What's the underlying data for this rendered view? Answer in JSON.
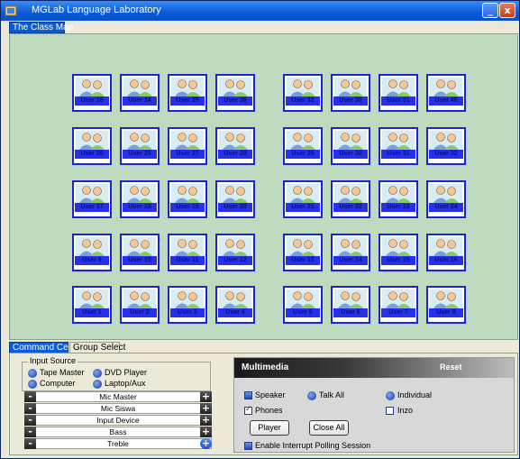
{
  "window": {
    "title": "MGLab Language Laboratory",
    "minimize_label": "_",
    "close_label": "x"
  },
  "top_tabs": [
    {
      "label": "The Class Map"
    }
  ],
  "seats": [
    "User 16",
    "User 14",
    "User 25",
    "User 36",
    "User 32",
    "User 30",
    "User 31",
    "User 40",
    "User 26",
    "User 25",
    "User 27",
    "User 28",
    "User 29",
    "User 30",
    "User 31",
    "User 32",
    "User 17",
    "User 18",
    "User 19",
    "User 20",
    "User 21",
    "User 22",
    "User 23",
    "User 24",
    "User 9",
    "User 10",
    "User 11",
    "User 12",
    "User 13",
    "User 14",
    "User 15",
    "User 16",
    "User 1",
    "User 2",
    "User 3",
    "User 4",
    "User 5",
    "User 6",
    "User 7",
    "User 8"
  ],
  "bottom_tabs": [
    {
      "label": "Command Center"
    },
    {
      "label": "Group Select"
    }
  ],
  "input_source": {
    "legend": "Input Source",
    "options": [
      {
        "label": "Tape Master",
        "selected": true
      },
      {
        "label": "DVD Player",
        "selected": false
      },
      {
        "label": "Computer",
        "selected": false
      },
      {
        "label": "Laptop/Aux",
        "selected": false
      }
    ]
  },
  "controls": [
    {
      "label": "Mic Master",
      "minus": "-",
      "plus": "+"
    },
    {
      "label": "Mic Siswa",
      "minus": "-",
      "plus": "+"
    },
    {
      "label": "Input Device",
      "minus": "-",
      "plus": "+"
    },
    {
      "label": "Bass",
      "minus": "-",
      "plus": "+"
    },
    {
      "label": "Treble",
      "minus": "-",
      "plus": "+"
    }
  ],
  "multimedia": {
    "title": "Multimedia",
    "reset": "Reset",
    "speaker": "Speaker",
    "talk_all": "Talk All",
    "individual": "Individual",
    "phones": "Phones",
    "inzo": "Inzo",
    "player_btn": "Player",
    "close_all_btn": "Close All",
    "polling": "Enable Interrupt Polling Session"
  },
  "colors": {
    "title_bar": "#0a5ad6",
    "class_map_bg": "#bfdbbf",
    "seat_border": "#1b22d8",
    "seat_label_bg": "#2530e8"
  }
}
